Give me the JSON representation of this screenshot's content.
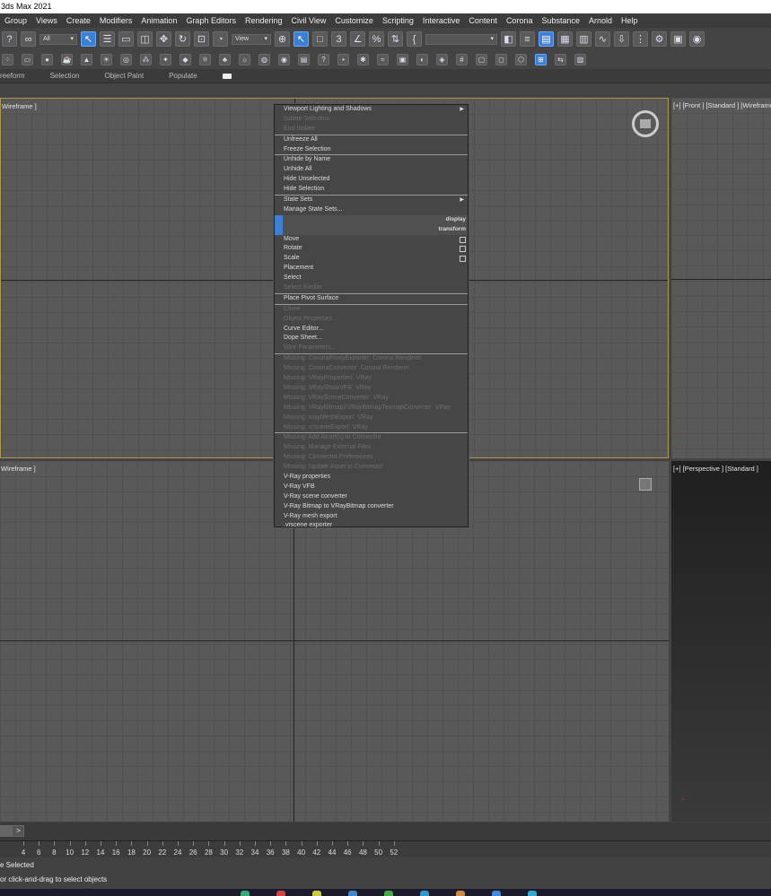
{
  "window": {
    "title": "3ds Max 2021"
  },
  "menubar": [
    "Group",
    "Views",
    "Create",
    "Modifiers",
    "Animation",
    "Graph Editors",
    "Rendering",
    "Civil View",
    "Customize",
    "Scripting",
    "Interactive",
    "Content",
    "Corona",
    "Substance",
    "Arnold",
    "Help"
  ],
  "toolbar": {
    "selection_filter": "All",
    "ref_coord": "View",
    "named_selection": "",
    "snap_label": "3",
    "icons_row1": [
      "help-icon",
      "link-icon",
      "filter-dropdown",
      "select-object-icon",
      "select-by-name-icon",
      "rect-region-icon",
      "window-crossing-icon",
      "move-icon",
      "rotate-icon",
      "scale-icon",
      "place-icon",
      "ref-coord-dropdown",
      "pivot-icon",
      "select-manipulate-icon",
      "keyboard-shortcut-icon",
      "snap-icon",
      "angle-snap-icon",
      "percent-snap-icon",
      "spinner-snap-icon",
      "edit-named-sel-icon",
      "named-sel-dropdown",
      "mirror-icon",
      "align-icon",
      "scene-explorer-icon",
      "layer-explorer-icon",
      "ribbon-icon",
      "curve-editor-icon",
      "schematic-icon",
      "material-editor-icon",
      "render-setup-icon",
      "render-frame-icon",
      "render-icon"
    ],
    "icons_row2": [
      "scatter-icon",
      "box-icon",
      "sphere-icon",
      "teapot-icon",
      "cone-icon",
      "light-icon",
      "torus-icon",
      "particle-icon",
      "physics-icon",
      "helper-icon",
      "space-warp-icon",
      "tree-icon",
      "sun-icon",
      "material-icon",
      "render-icon",
      "clipboard-icon",
      "help-circle-icon",
      "light-bulb-icon",
      "omni-icon",
      "flow-icon",
      "camera-icon",
      "settings-icon",
      "render-elements-icon",
      "grid-icon",
      "proxy-icon",
      "frame-icon",
      "mesh-icon",
      "snap-grid-icon",
      "toggle-icon",
      "fill-icon"
    ]
  },
  "ribbon": {
    "tabs": [
      "reeform",
      "Selection",
      "Object Paint",
      "Populate"
    ]
  },
  "viewports": {
    "top_left_label": "Wireframe ]",
    "top_right_label": "[+] [Front ] [Standard ] [Wireframe",
    "bottom_left_label": "Wireframe ]",
    "bottom_right_label": "[+] [Perspective ] [Standard ]"
  },
  "quad_menu": {
    "items": [
      {
        "label": "Viewport Lighting and Shadows",
        "state": "enabled",
        "submenu": true
      },
      {
        "label": "Isolate Selection",
        "state": "disabled"
      },
      {
        "label": "End Isolate",
        "state": "disabled"
      },
      {
        "sep": true
      },
      {
        "label": "Unfreeze All",
        "state": "enabled"
      },
      {
        "label": "Freeze Selection",
        "state": "enabled"
      },
      {
        "sep": true
      },
      {
        "label": "Unhide by Name",
        "state": "enabled"
      },
      {
        "label": "Unhide All",
        "state": "enabled"
      },
      {
        "label": "Hide Unselected",
        "state": "enabled"
      },
      {
        "label": "Hide Selection",
        "state": "enabled"
      },
      {
        "sep": true
      },
      {
        "label": "State Sets",
        "state": "enabled",
        "submenu": true
      },
      {
        "label": "Manage State Sets...",
        "state": "enabled"
      },
      {
        "section": "display"
      },
      {
        "section": "transform"
      },
      {
        "label": "Move",
        "state": "enabled",
        "box": true
      },
      {
        "label": "Rotate",
        "state": "enabled",
        "box": true
      },
      {
        "label": "Scale",
        "state": "enabled",
        "box": true
      },
      {
        "label": "Placement",
        "state": "enabled"
      },
      {
        "label": "Select",
        "state": "enabled"
      },
      {
        "label": "Select Similar",
        "state": "disabled"
      },
      {
        "sep": true
      },
      {
        "label": "Place Pivot Surface",
        "state": "enabled"
      },
      {
        "sep": true
      },
      {
        "label": "Clone",
        "state": "disabled"
      },
      {
        "label": "Object Properties...",
        "state": "disabled"
      },
      {
        "label": "Curve Editor...",
        "state": "enabled"
      },
      {
        "label": "Dope Sheet...",
        "state": "enabled"
      },
      {
        "label": "Wire Parameters...",
        "state": "disabled"
      },
      {
        "sep": true
      },
      {
        "label": "Missing: CoronaProxyExporter` Corona Renderer",
        "state": "disabled"
      },
      {
        "label": "Missing: CoronaConverter` Corona Renderer",
        "state": "disabled"
      },
      {
        "label": "Missing: VRayProperties` VRay",
        "state": "disabled"
      },
      {
        "label": "Missing: VRayShowVFB` VRay",
        "state": "disabled"
      },
      {
        "label": "Missing: VRaySceneConverter` VRay",
        "state": "disabled"
      },
      {
        "label": "Missing: VRayBitmap2VRayBitmapTexmapConverter` VRay",
        "state": "disabled"
      },
      {
        "label": "Missing: vrayMeshExport` VRay",
        "state": "disabled"
      },
      {
        "label": "Missing: vrsceneExport` VRay",
        "state": "disabled"
      },
      {
        "sep": true
      },
      {
        "label": "Missing: Add Asset(s) to Connector",
        "state": "disabled"
      },
      {
        "label": "Missing: Manage External Files",
        "state": "disabled"
      },
      {
        "label": "Missing: Connector Preferences",
        "state": "disabled"
      },
      {
        "label": "Missing: Update Asset in Connector",
        "state": "disabled"
      },
      {
        "label": "V-Ray properties",
        "state": "enabled"
      },
      {
        "label": "V-Ray VFB",
        "state": "enabled"
      },
      {
        "label": "V-Ray scene converter",
        "state": "enabled"
      },
      {
        "label": "V-Ray Bitmap to VRayBitmap converter",
        "state": "enabled"
      },
      {
        "label": "V-Ray mesh export",
        "state": "enabled"
      },
      {
        "label": ".vrscene exporter",
        "state": "enabled"
      }
    ]
  },
  "timeline": {
    "slider_label": ">",
    "ticks": [
      "4",
      "6",
      "8",
      "10",
      "12",
      "14",
      "16",
      "18",
      "20",
      "22",
      "24",
      "26",
      "28",
      "30",
      "32",
      "34",
      "36",
      "38",
      "40",
      "42",
      "44",
      "46",
      "48",
      "50",
      "52"
    ]
  },
  "status": {
    "line1": "e Selected",
    "line2": "or click-and-drag to select objects"
  },
  "colors": {
    "accent": "#3d7fd0",
    "active_border": "#b09a53"
  }
}
